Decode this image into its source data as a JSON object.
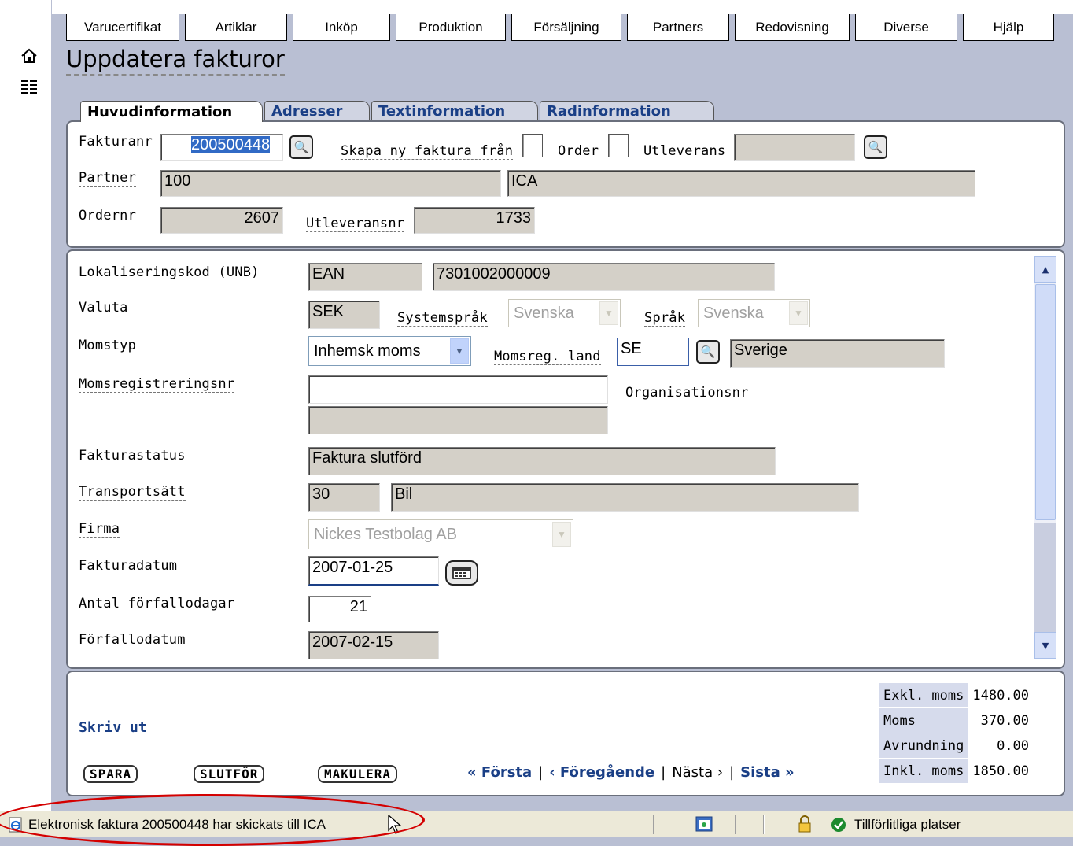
{
  "menu": [
    "Varucertifikat",
    "Artiklar",
    "Inköp",
    "Produktion",
    "Försäljning",
    "Partners",
    "Redovisning",
    "Diverse",
    "Hjälp"
  ],
  "page": {
    "title": "Uppdatera fakturor"
  },
  "tabs": [
    "Huvudinformation",
    "Adresser",
    "Textinformation",
    "Radinformation"
  ],
  "head": {
    "fakturanr_label": "Fakturanr",
    "fakturanr_value": "200500448",
    "skapa_label": "Skapa ny faktura från",
    "order_label": "Order",
    "utleverans_label": "Utleverans",
    "utleverans_value": "",
    "partner_label": "Partner",
    "partner_id": "100",
    "partner_name": "ICA",
    "ordernr_label": "Ordernr",
    "ordernr_value": "2607",
    "utleveransnr_label": "Utleveransnr",
    "utleveransnr_value": "1733"
  },
  "details": {
    "lokkod_label": "Lokaliseringskod (UNB)",
    "lokkod_type": "EAN",
    "lokkod_value": "7301002000009",
    "valuta_label": "Valuta",
    "valuta_value": "SEK",
    "systemsprak_label": "Systemspråk",
    "systemsprak_value": "Svenska",
    "sprak_label": "Språk",
    "sprak_value": "Svenska",
    "momstyp_label": "Momstyp",
    "momstyp_value": "Inhemsk moms",
    "momsreg_land_label": "Momsreg. land",
    "momsreg_land_code": "SE",
    "momsreg_land_name": "Sverige",
    "momsregnr_label": "Momsregistreringsnr",
    "momsregnr_value": "",
    "orgnr_label": "Organisationsnr",
    "orgnr_value": "",
    "fakturastatus_label": "Fakturastatus",
    "fakturastatus_value": "Faktura slutförd",
    "transport_label": "Transportsätt",
    "transport_code": "30",
    "transport_name": "Bil",
    "firma_label": "Firma",
    "firma_value": "Nickes Testbolag AB",
    "fakturadatum_label": "Fakturadatum",
    "fakturadatum_value": "2007-01-25",
    "forfallodagar_label": "Antal förfallodagar",
    "forfallodagar_value": "21",
    "forfallodatum_label": "Förfallodatum",
    "forfallodatum_value": "2007-02-15"
  },
  "footer": {
    "print_link": "Skriv ut",
    "save_button": "SPARA",
    "finish_button": "SLUTFÖR",
    "cancel_button": "MAKULERA",
    "nav_first": "« Första",
    "nav_prev": "‹ Föregående",
    "nav_next": "Nästa ›",
    "nav_last": "Sista »",
    "nav_sep": "|",
    "totals": [
      {
        "label": "Exkl. moms",
        "value": "1480.00"
      },
      {
        "label": "Moms",
        "value": "370.00"
      },
      {
        "label": "Avrundning",
        "value": "0.00"
      },
      {
        "label": "Inkl. moms",
        "value": "1850.00"
      }
    ]
  },
  "status": {
    "message": "Elektronisk faktura 200500448 har skickats till ICA",
    "zone": "Tillförlitliga platser"
  },
  "colors": {
    "accent": "#1a3f86",
    "background": "#b9bfd3",
    "highlight_circle": "#d40000"
  }
}
